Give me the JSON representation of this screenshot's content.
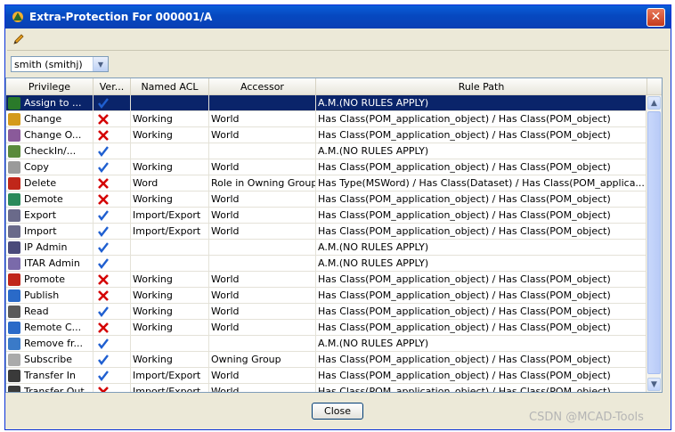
{
  "window": {
    "title": "Extra-Protection For 000001/A",
    "close_glyph": "✕"
  },
  "toolbar": {
    "edit_icon": "pencil-icon"
  },
  "user_selector": {
    "value": "smith (smithj)",
    "dropdown_icon": "chevron-down-icon"
  },
  "table": {
    "columns": [
      "Privilege",
      "Ver...",
      "Named ACL",
      "Accessor",
      "Rule Path"
    ],
    "rows": [
      {
        "privilege": "Assign to ...",
        "icon": "assign-icon",
        "icon_color": "#2a7a2a",
        "verdict": "check",
        "named_acl": "",
        "accessor": "",
        "rule_path": "A.M.(NO RULES APPLY)",
        "selected": true
      },
      {
        "privilege": "Change",
        "icon": "change-icon",
        "icon_color": "#d49a1c",
        "verdict": "cross",
        "named_acl": "Working",
        "accessor": "World",
        "rule_path": "Has Class(POM_application_object) / Has Class(POM_object)"
      },
      {
        "privilege": "Change O...",
        "icon": "change-owner-icon",
        "icon_color": "#8a5a9a",
        "verdict": "cross",
        "named_acl": "Working",
        "accessor": "World",
        "rule_path": "Has Class(POM_application_object) / Has Class(POM_object)"
      },
      {
        "privilege": "CheckIn/...",
        "icon": "checkin-icon",
        "icon_color": "#5a8a3a",
        "verdict": "check",
        "named_acl": "",
        "accessor": "",
        "rule_path": "A.M.(NO RULES APPLY)"
      },
      {
        "privilege": "Copy",
        "icon": "copy-icon",
        "icon_color": "#9a9a9a",
        "verdict": "check",
        "named_acl": "Working",
        "accessor": "World",
        "rule_path": "Has Class(POM_application_object) / Has Class(POM_object)"
      },
      {
        "privilege": "Delete",
        "icon": "delete-icon",
        "icon_color": "#c0261a",
        "verdict": "cross",
        "named_acl": "Word",
        "accessor": "Role in Owning Group",
        "rule_path": "Has Type(MSWord) / Has Class(Dataset) / Has Class(POM_applica..."
      },
      {
        "privilege": "Demote",
        "icon": "demote-icon",
        "icon_color": "#2a8a5a",
        "verdict": "cross",
        "named_acl": "Working",
        "accessor": "World",
        "rule_path": "Has Class(POM_application_object) / Has Class(POM_object)"
      },
      {
        "privilege": "Export",
        "icon": "export-icon",
        "icon_color": "#6a6a8a",
        "verdict": "check",
        "named_acl": "Import/Export",
        "accessor": "World",
        "rule_path": "Has Class(POM_application_object) / Has Class(POM_object)"
      },
      {
        "privilege": "Import",
        "icon": "import-icon",
        "icon_color": "#6a6a8a",
        "verdict": "check",
        "named_acl": "Import/Export",
        "accessor": "World",
        "rule_path": "Has Class(POM_application_object) / Has Class(POM_object)"
      },
      {
        "privilege": "IP Admin",
        "icon": "ip-admin-icon",
        "icon_color": "#4a4a7a",
        "verdict": "check",
        "named_acl": "",
        "accessor": "",
        "rule_path": "A.M.(NO RULES APPLY)"
      },
      {
        "privilege": "ITAR Admin",
        "icon": "itar-admin-icon",
        "icon_color": "#7a6aaa",
        "verdict": "check",
        "named_acl": "",
        "accessor": "",
        "rule_path": "A.M.(NO RULES APPLY)"
      },
      {
        "privilege": "Promote",
        "icon": "promote-icon",
        "icon_color": "#c0261a",
        "verdict": "cross",
        "named_acl": "Working",
        "accessor": "World",
        "rule_path": "Has Class(POM_application_object) / Has Class(POM_object)"
      },
      {
        "privilege": "Publish",
        "icon": "publish-icon",
        "icon_color": "#2a6ac8",
        "verdict": "cross",
        "named_acl": "Working",
        "accessor": "World",
        "rule_path": "Has Class(POM_application_object) / Has Class(POM_object)"
      },
      {
        "privilege": "Read",
        "icon": "read-icon",
        "icon_color": "#5a5a5a",
        "verdict": "check",
        "named_acl": "Working",
        "accessor": "World",
        "rule_path": "Has Class(POM_application_object) / Has Class(POM_object)"
      },
      {
        "privilege": "Remote C...",
        "icon": "remote-checkout-icon",
        "icon_color": "#2a6ac8",
        "verdict": "cross",
        "named_acl": "Working",
        "accessor": "World",
        "rule_path": "Has Class(POM_application_object) / Has Class(POM_object)"
      },
      {
        "privilege": "Remove fr...",
        "icon": "remove-from-icon",
        "icon_color": "#3a7ac8",
        "verdict": "check",
        "named_acl": "",
        "accessor": "",
        "rule_path": "A.M.(NO RULES APPLY)"
      },
      {
        "privilege": "Subscribe",
        "icon": "subscribe-icon",
        "icon_color": "#aaaaaa",
        "verdict": "check",
        "named_acl": "Working",
        "accessor": "Owning Group",
        "rule_path": "Has Class(POM_application_object) / Has Class(POM_object)"
      },
      {
        "privilege": "Transfer In",
        "icon": "transfer-in-icon",
        "icon_color": "#3a3a3a",
        "verdict": "check",
        "named_acl": "Import/Export",
        "accessor": "World",
        "rule_path": "Has Class(POM_application_object) / Has Class(POM_object)"
      },
      {
        "privilege": "Transfer Out",
        "icon": "transfer-out-icon",
        "icon_color": "#3a3a3a",
        "verdict": "cross",
        "named_acl": "Import/Export",
        "accessor": "World",
        "rule_path": "Has Class(POM_application_object) / Has Class(POM_object)"
      }
    ]
  },
  "footer": {
    "close_label": "Close"
  },
  "watermark": "CSDN @MCAD-Tools",
  "colors": {
    "check": "#1f5fd0",
    "cross": "#d40000",
    "selection": "#0a246a"
  }
}
